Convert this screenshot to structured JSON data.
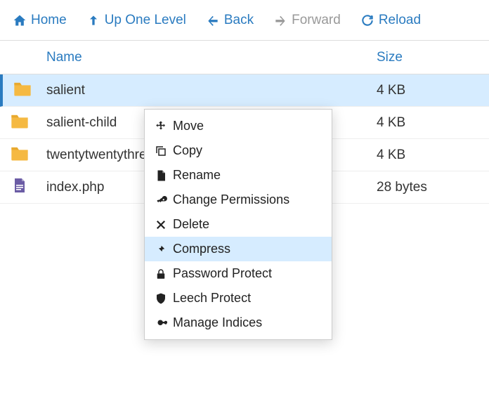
{
  "toolbar": {
    "home": "Home",
    "up": "Up One Level",
    "back": "Back",
    "forward": "Forward",
    "reload": "Reload"
  },
  "columns": {
    "name": "Name",
    "size": "Size"
  },
  "rows": [
    {
      "type": "folder",
      "name": "salient",
      "size": "4 KB",
      "selected": true
    },
    {
      "type": "folder",
      "name": "salient-child",
      "size": "4 KB",
      "selected": false
    },
    {
      "type": "folder",
      "name": "twentytwentythree",
      "size": "4 KB",
      "selected": false
    },
    {
      "type": "file-php",
      "name": "index.php",
      "size": "28 bytes",
      "selected": false
    }
  ],
  "context_menu": {
    "items": [
      {
        "icon": "move-icon",
        "label": "Move"
      },
      {
        "icon": "copy-icon",
        "label": "Copy"
      },
      {
        "icon": "rename-icon",
        "label": "Rename"
      },
      {
        "icon": "permissions-icon",
        "label": "Change Permissions"
      },
      {
        "icon": "delete-icon",
        "label": "Delete"
      },
      {
        "icon": "compress-icon",
        "label": "Compress"
      },
      {
        "icon": "password-icon",
        "label": "Password Protect"
      },
      {
        "icon": "leech-icon",
        "label": "Leech Protect"
      },
      {
        "icon": "indices-icon",
        "label": "Manage Indices"
      }
    ],
    "hovered_index": 5
  },
  "colors": {
    "accent": "#2a7bc0",
    "folder": "#f5b942",
    "file_php": "#6b5ca5"
  }
}
